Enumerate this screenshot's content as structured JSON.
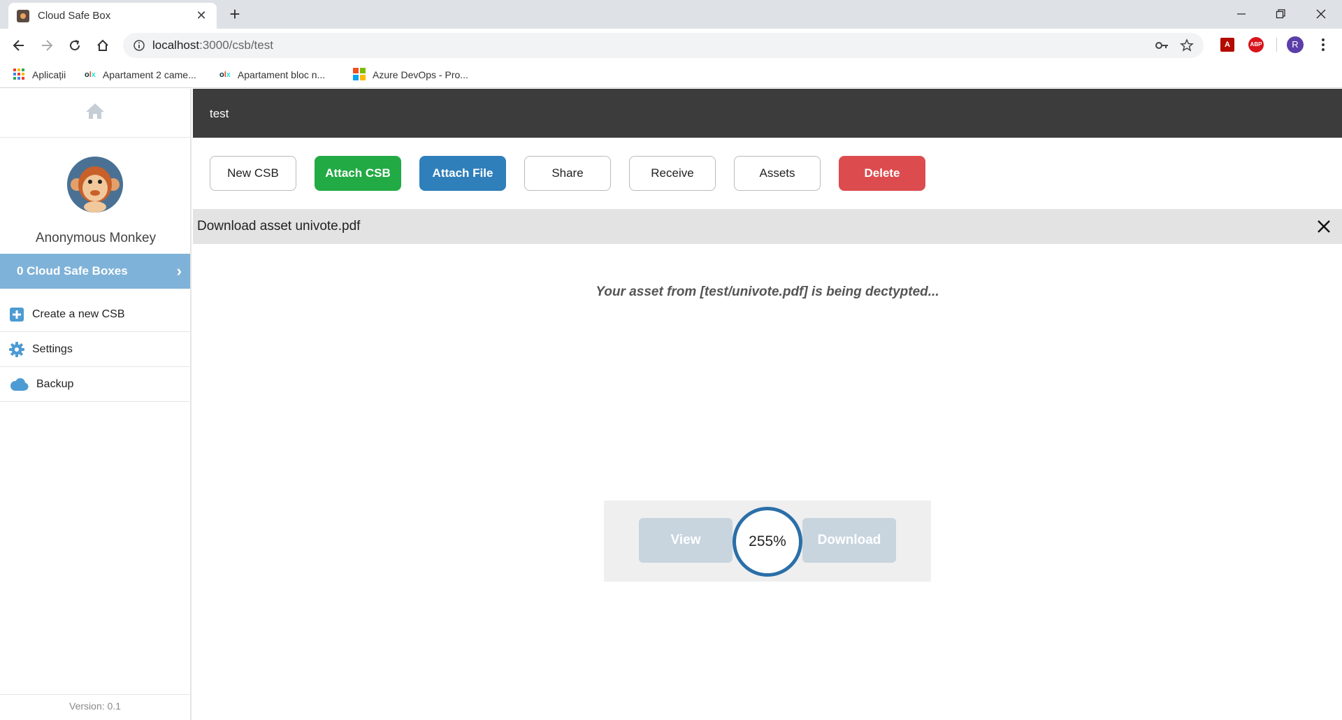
{
  "browser": {
    "tab_title": "Cloud Safe Box",
    "url_host": "localhost",
    "url_rest": ":3000/csb/test",
    "profile_initial": "R",
    "bookmarks": [
      {
        "label": "Aplicații",
        "icon": "apps-grid-icon"
      },
      {
        "label": "Apartament 2 came...",
        "icon": "olx-icon"
      },
      {
        "label": "Apartament bloc n...",
        "icon": "olx-icon"
      },
      {
        "label": "Azure DevOps - Pro...",
        "icon": "microsoft-icon"
      }
    ]
  },
  "sidebar": {
    "user_name": "Anonymous Monkey",
    "csb_count_label": "0 Cloud Safe Boxes",
    "menu": [
      {
        "label": "Create a new CSB",
        "icon": "plus-square-icon"
      },
      {
        "label": "Settings",
        "icon": "gear-icon"
      },
      {
        "label": "Backup",
        "icon": "cloud-icon"
      }
    ],
    "version": "Version: 0.1"
  },
  "main": {
    "header_title": "test",
    "actions": {
      "new_csb": "New CSB",
      "attach_csb": "Attach CSB",
      "attach_file": "Attach File",
      "share": "Share",
      "receive": "Receive",
      "assets": "Assets",
      "delete": "Delete"
    },
    "dialog": {
      "title": "Download asset univote.pdf",
      "status": "Your asset from [test/univote.pdf] is being dectypted...",
      "view_label": "View",
      "download_label": "Download",
      "progress_label": "255%"
    }
  },
  "colors": {
    "accent_blue": "#2f7fbb",
    "success_green": "#22aa44",
    "danger_red": "#dc4c4f",
    "sidebar_highlight": "#7fb2d8",
    "header_dark": "#3c3c3c"
  }
}
